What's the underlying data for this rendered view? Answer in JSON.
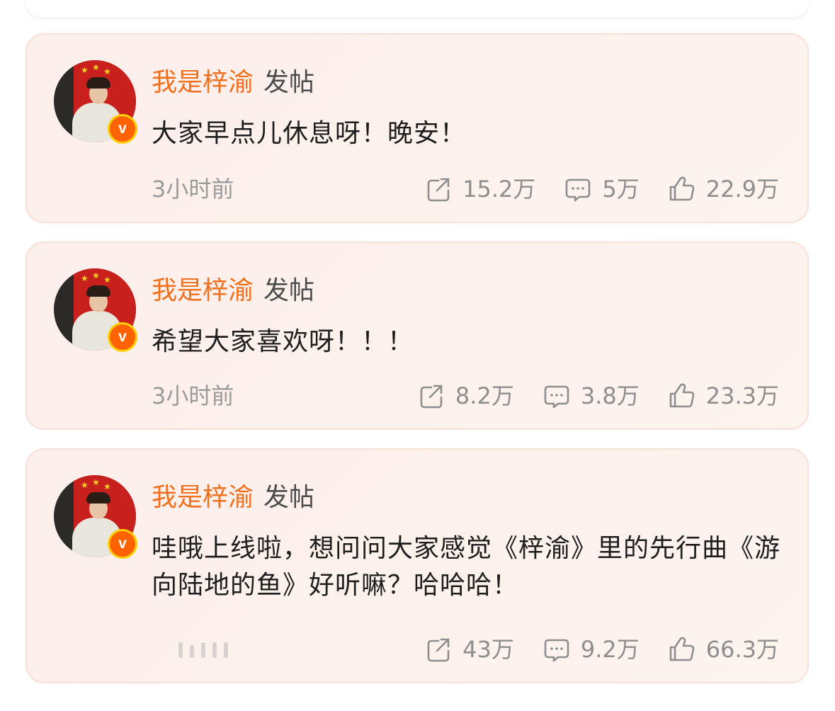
{
  "posts": [
    {
      "author": "我是梓渝",
      "action": "发帖",
      "content": "大家早点儿休息呀！晚安！",
      "time": "3小时前",
      "shares": "15.2万",
      "comments": "5万",
      "likes": "22.9万"
    },
    {
      "author": "我是梓渝",
      "action": "发帖",
      "content": "希望大家喜欢呀！！！",
      "time": "3小时前",
      "shares": "8.2万",
      "comments": "3.8万",
      "likes": "23.3万"
    },
    {
      "author": "我是梓渝",
      "action": "发帖",
      "content": "哇哦上线啦，想问问大家感觉《梓渝》里的先行曲《游向陆地的鱼》好听嘛？哈哈哈！",
      "time": "",
      "shares": "43万",
      "comments": "9.2万",
      "likes": "66.3万"
    }
  ],
  "icons": {
    "share": "share-icon",
    "comment": "comment-icon",
    "like": "like-icon",
    "verified": "verified-v-badge"
  },
  "colors": {
    "author_name": "#f0701e",
    "card_background": "#fdf0ec",
    "card_border": "#f9dfd6",
    "meta_text": "#9a9a9a",
    "verified_badge": "#ff6200"
  }
}
